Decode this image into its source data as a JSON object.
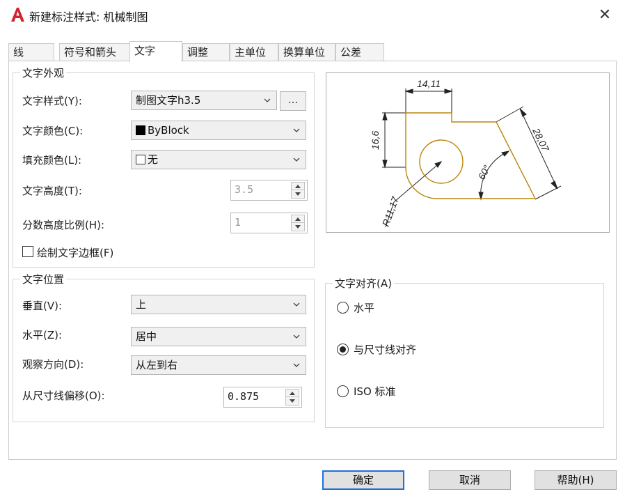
{
  "window": {
    "title": "新建标注样式: 机械制图",
    "close_glyph": "✕"
  },
  "tabs": [
    {
      "label": "线"
    },
    {
      "label": "符号和箭头"
    },
    {
      "label": "文字",
      "active": true
    },
    {
      "label": "调整"
    },
    {
      "label": "主单位"
    },
    {
      "label": "换算单位"
    },
    {
      "label": "公差"
    }
  ],
  "text_appearance": {
    "title": "文字外观",
    "style_label": "文字样式(Y):",
    "style_value": "制图文字h3.5",
    "style_button": "...",
    "color_label": "文字颜色(C):",
    "color_value": "ByBlock",
    "fill_label": "填充颜色(L):",
    "fill_value": "无",
    "height_label": "文字高度(T):",
    "height_value": "3.5",
    "fraction_label": "分数高度比例(H):",
    "fraction_value": "1",
    "frame_label": "绘制文字边框(F)",
    "frame_checked": false
  },
  "text_placement": {
    "title": "文字位置",
    "vertical_label": "垂直(V):",
    "vertical_value": "上",
    "horizontal_label": "水平(Z):",
    "horizontal_value": "居中",
    "view_label": "观察方向(D):",
    "view_value": "从左到右",
    "offset_label": "从尺寸线偏移(O):",
    "offset_value": "0.875"
  },
  "text_alignment": {
    "title": "文字对齐(A)",
    "options": [
      {
        "label": "水平",
        "checked": false
      },
      {
        "label": "与尺寸线对齐",
        "checked": true
      },
      {
        "label": "ISO 标准",
        "checked": false
      }
    ]
  },
  "preview": {
    "dim_top": "14,11",
    "dim_left": "16,6",
    "dim_right": "28,07",
    "dim_angle": "60°",
    "dim_radius": "R11,17",
    "part_color": "#b8860b"
  },
  "buttons": {
    "ok": "确定",
    "cancel": "取消",
    "help": "帮助(H)"
  }
}
